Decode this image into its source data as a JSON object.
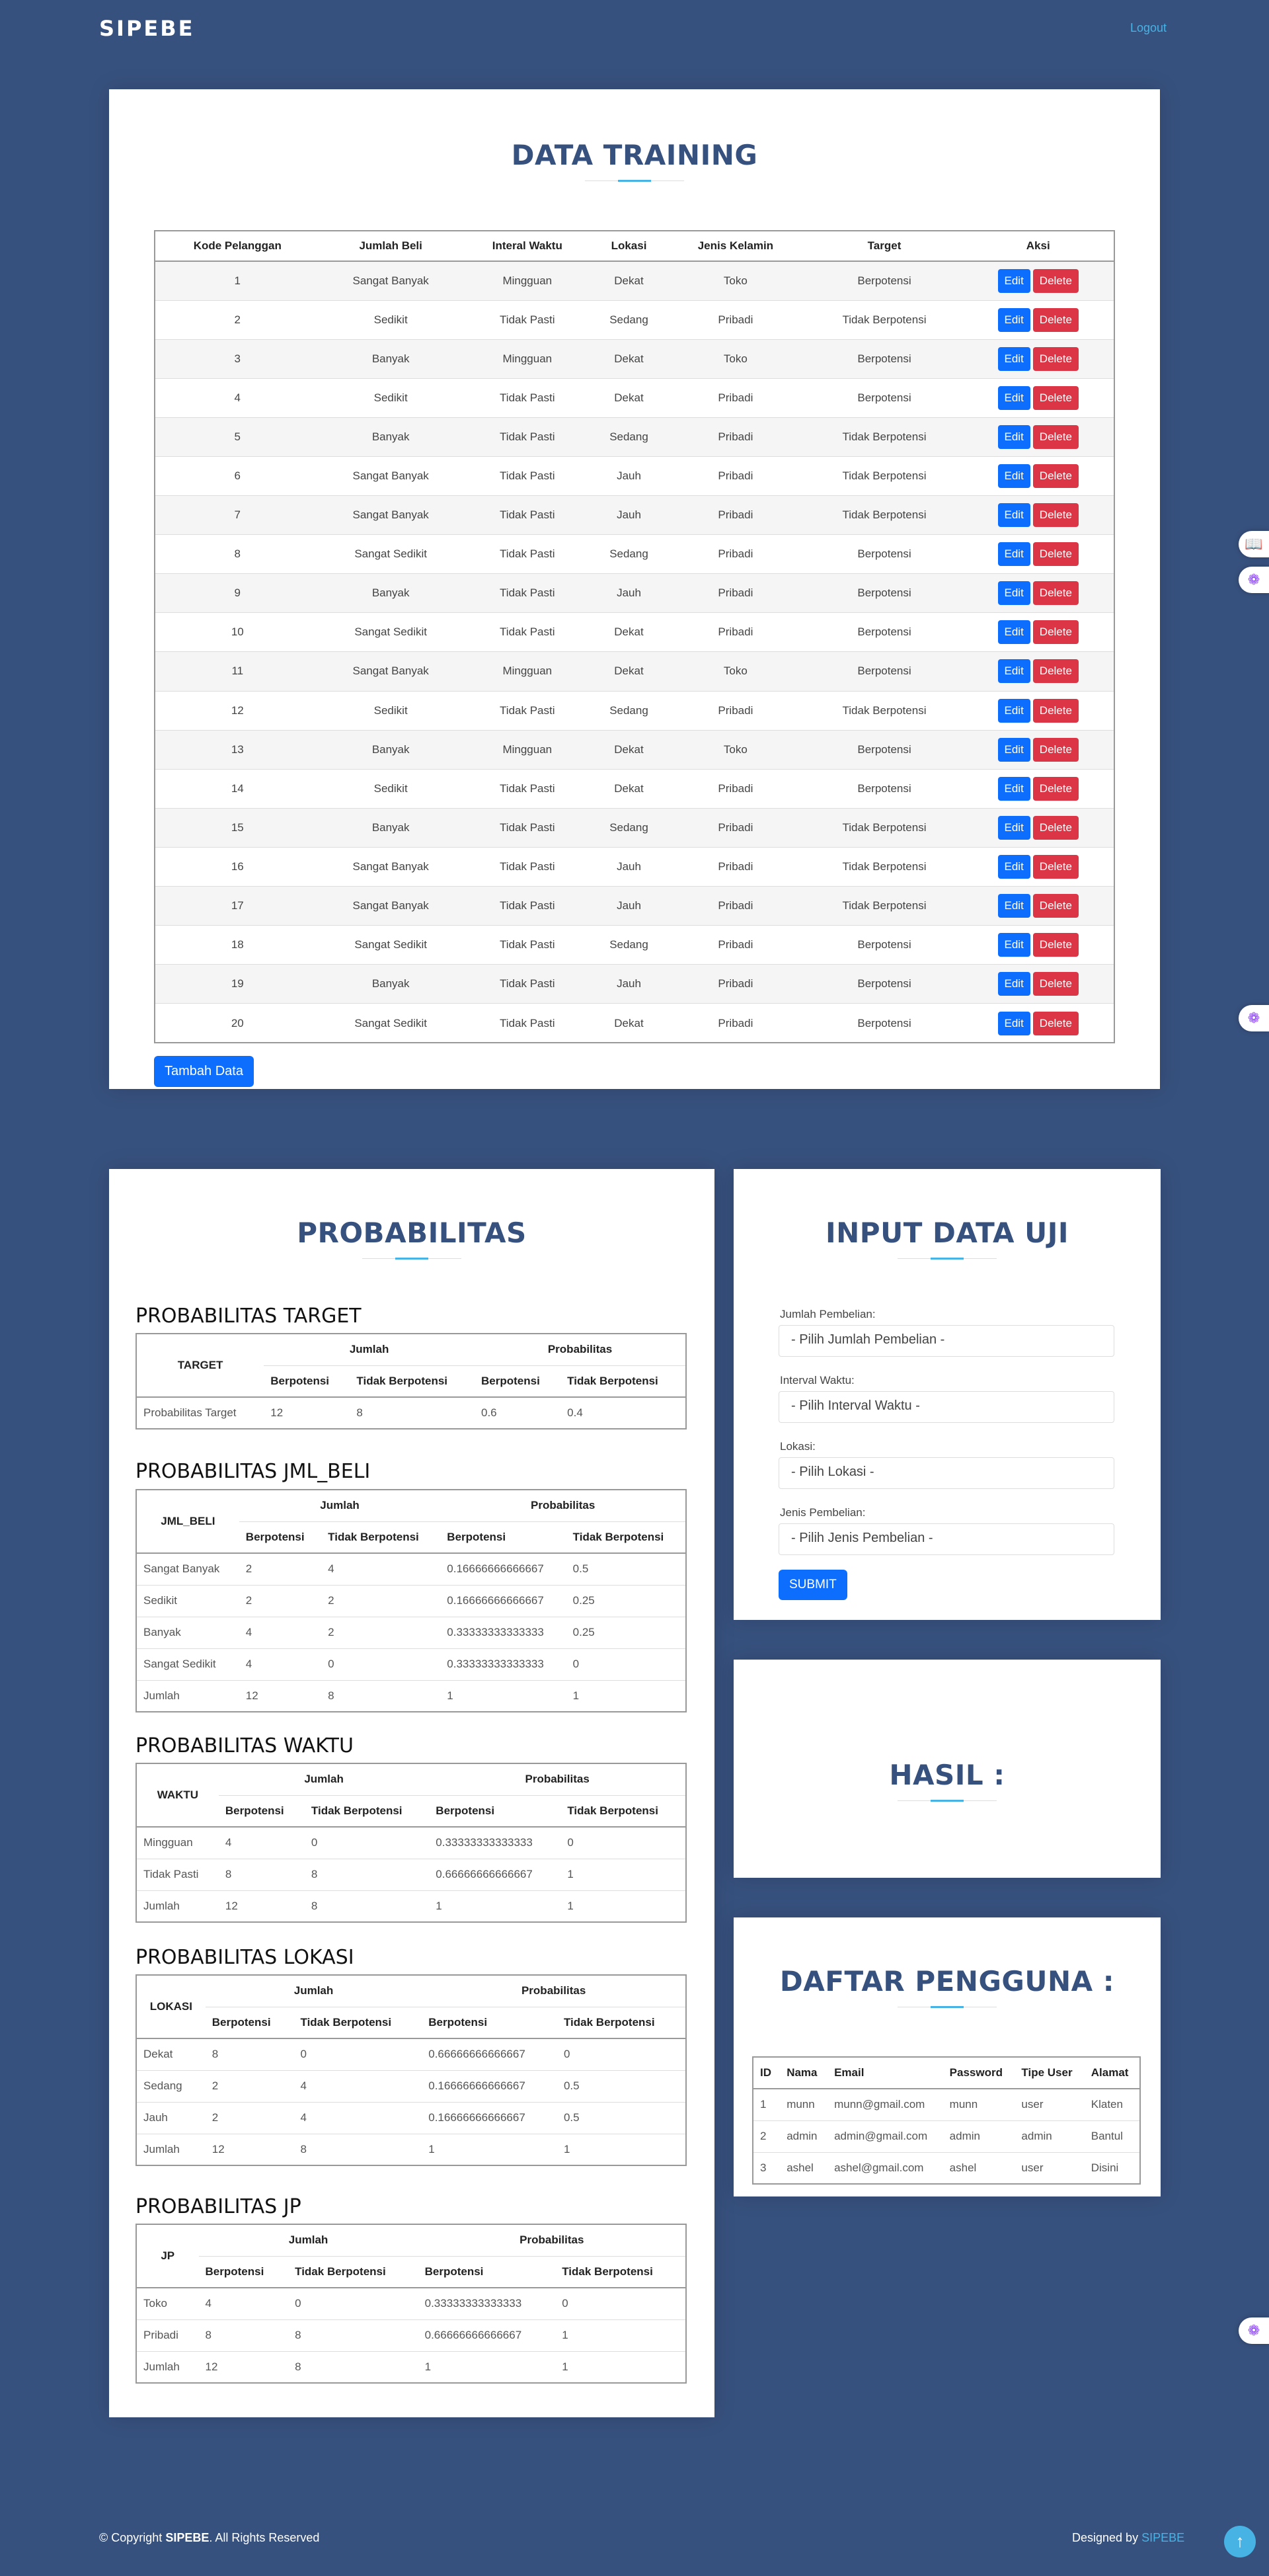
{
  "header": {
    "logo": "SIPEBE",
    "logout": "Logout"
  },
  "training": {
    "title": "DATA TRAINING",
    "columns": [
      "Kode Pelanggan",
      "Jumlah Beli",
      "Interal Waktu",
      "Lokasi",
      "Jenis Kelamin",
      "Target",
      "Aksi"
    ],
    "edit_label": "Edit",
    "delete_label": "Delete",
    "add_label": "Tambah Data",
    "rows": [
      [
        "1",
        "Sangat Banyak",
        "Mingguan",
        "Dekat",
        "Toko",
        "Berpotensi"
      ],
      [
        "2",
        "Sedikit",
        "Tidak Pasti",
        "Sedang",
        "Pribadi",
        "Tidak Berpotensi"
      ],
      [
        "3",
        "Banyak",
        "Mingguan",
        "Dekat",
        "Toko",
        "Berpotensi"
      ],
      [
        "4",
        "Sedikit",
        "Tidak Pasti",
        "Dekat",
        "Pribadi",
        "Berpotensi"
      ],
      [
        "5",
        "Banyak",
        "Tidak Pasti",
        "Sedang",
        "Pribadi",
        "Tidak Berpotensi"
      ],
      [
        "6",
        "Sangat Banyak",
        "Tidak Pasti",
        "Jauh",
        "Pribadi",
        "Tidak Berpotensi"
      ],
      [
        "7",
        "Sangat Banyak",
        "Tidak Pasti",
        "Jauh",
        "Pribadi",
        "Tidak Berpotensi"
      ],
      [
        "8",
        "Sangat Sedikit",
        "Tidak Pasti",
        "Sedang",
        "Pribadi",
        "Berpotensi"
      ],
      [
        "9",
        "Banyak",
        "Tidak Pasti",
        "Jauh",
        "Pribadi",
        "Berpotensi"
      ],
      [
        "10",
        "Sangat Sedikit",
        "Tidak Pasti",
        "Dekat",
        "Pribadi",
        "Berpotensi"
      ],
      [
        "11",
        "Sangat Banyak",
        "Mingguan",
        "Dekat",
        "Toko",
        "Berpotensi"
      ],
      [
        "12",
        "Sedikit",
        "Tidak Pasti",
        "Sedang",
        "Pribadi",
        "Tidak Berpotensi"
      ],
      [
        "13",
        "Banyak",
        "Mingguan",
        "Dekat",
        "Toko",
        "Berpotensi"
      ],
      [
        "14",
        "Sedikit",
        "Tidak Pasti",
        "Dekat",
        "Pribadi",
        "Berpotensi"
      ],
      [
        "15",
        "Banyak",
        "Tidak Pasti",
        "Sedang",
        "Pribadi",
        "Tidak Berpotensi"
      ],
      [
        "16",
        "Sangat Banyak",
        "Tidak Pasti",
        "Jauh",
        "Pribadi",
        "Tidak Berpotensi"
      ],
      [
        "17",
        "Sangat Banyak",
        "Tidak Pasti",
        "Jauh",
        "Pribadi",
        "Tidak Berpotensi"
      ],
      [
        "18",
        "Sangat Sedikit",
        "Tidak Pasti",
        "Sedang",
        "Pribadi",
        "Berpotensi"
      ],
      [
        "19",
        "Banyak",
        "Tidak Pasti",
        "Jauh",
        "Pribadi",
        "Berpotensi"
      ],
      [
        "20",
        "Sangat Sedikit",
        "Tidak Pasti",
        "Dekat",
        "Pribadi",
        "Berpotensi"
      ]
    ]
  },
  "probabilitas": {
    "title": "PROBABILITAS",
    "jumlah_label": "Jumlah",
    "prob_label": "Probabilitas",
    "berpotensi_label": "Berpotensi",
    "tidak_label": "Tidak Berpotensi",
    "tables": [
      {
        "title": "PROBABILITAS TARGET",
        "key_label": "TARGET",
        "rows": [
          [
            "Probabilitas Target",
            "12",
            "8",
            "0.6",
            "0.4"
          ]
        ]
      },
      {
        "title": "PROBABILITAS JML_BELI",
        "key_label": "JML_BELI",
        "rows": [
          [
            "Sangat Banyak",
            "2",
            "4",
            "0.16666666666667",
            "0.5"
          ],
          [
            "Sedikit",
            "2",
            "2",
            "0.16666666666667",
            "0.25"
          ],
          [
            "Banyak",
            "4",
            "2",
            "0.33333333333333",
            "0.25"
          ],
          [
            "Sangat Sedikit",
            "4",
            "0",
            "0.33333333333333",
            "0"
          ],
          [
            "Jumlah",
            "12",
            "8",
            "1",
            "1"
          ]
        ]
      },
      {
        "title": "PROBABILITAS WAKTU",
        "key_label": "WAKTU",
        "rows": [
          [
            "Mingguan",
            "4",
            "0",
            "0.33333333333333",
            "0"
          ],
          [
            "Tidak Pasti",
            "8",
            "8",
            "0.66666666666667",
            "1"
          ],
          [
            "Jumlah",
            "12",
            "8",
            "1",
            "1"
          ]
        ]
      },
      {
        "title": "PROBABILITAS LOKASI",
        "key_label": "LOKASI",
        "rows": [
          [
            "Dekat",
            "8",
            "0",
            "0.66666666666667",
            "0"
          ],
          [
            "Sedang",
            "2",
            "4",
            "0.16666666666667",
            "0.5"
          ],
          [
            "Jauh",
            "2",
            "4",
            "0.16666666666667",
            "0.5"
          ],
          [
            "Jumlah",
            "12",
            "8",
            "1",
            "1"
          ]
        ]
      },
      {
        "title": "PROBABILITAS JP",
        "key_label": "JP",
        "rows": [
          [
            "Toko",
            "4",
            "0",
            "0.33333333333333",
            "0"
          ],
          [
            "Pribadi",
            "8",
            "8",
            "0.66666666666667",
            "1"
          ],
          [
            "Jumlah",
            "12",
            "8",
            "1",
            "1"
          ]
        ]
      }
    ]
  },
  "input_uji": {
    "title": "INPUT DATA UJI",
    "fields": [
      {
        "label": "Jumlah Pembelian:",
        "value": "- Pilih Jumlah Pembelian -"
      },
      {
        "label": "Interval Waktu:",
        "value": "- Pilih Interval Waktu -"
      },
      {
        "label": "Lokasi:",
        "value": "- Pilih Lokasi -"
      },
      {
        "label": "Jenis Pembelian:",
        "value": "- Pilih Jenis Pembelian -"
      }
    ],
    "submit_label": "SUBMIT"
  },
  "hasil": {
    "title": "HASIL :"
  },
  "pengguna": {
    "title": "DAFTAR PENGGUNA :",
    "columns": [
      "ID",
      "Nama",
      "Email",
      "Password",
      "Tipe User",
      "Alamat"
    ],
    "rows": [
      [
        "1",
        "munn",
        "munn@gmail.com",
        "munn",
        "user",
        "Klaten"
      ],
      [
        "2",
        "admin",
        "admin@gmail.com",
        "admin",
        "admin",
        "Bantul"
      ],
      [
        "3",
        "ashel",
        "ashel@gmail.com",
        "ashel",
        "user",
        "Disini"
      ]
    ]
  },
  "footer": {
    "copyright_prefix": "© Copyright ",
    "brand": "SIPEBE",
    "copyright_suffix": ". All Rights Reserved",
    "designed_by": "Designed by ",
    "designer": "SIPEBE"
  },
  "icons": {
    "book": "book-icon",
    "translate": "translate-icon",
    "back_to_top": "arrow-up-icon"
  },
  "colors": {
    "background": "#37517e",
    "accent": "#47b2e4",
    "primary_button": "#0d6efd",
    "danger_button": "#dc3545"
  }
}
